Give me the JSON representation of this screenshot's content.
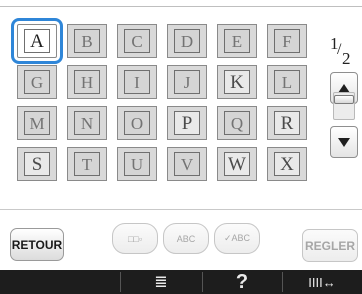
{
  "grid": {
    "cells": [
      {
        "label": "A",
        "kind": "letter",
        "selected": true
      },
      {
        "label": "B",
        "kind": "deco"
      },
      {
        "label": "C",
        "kind": "deco"
      },
      {
        "label": "D",
        "kind": "deco"
      },
      {
        "label": "E",
        "kind": "deco"
      },
      {
        "label": "F",
        "kind": "deco"
      },
      {
        "label": "G",
        "kind": "deco"
      },
      {
        "label": "H",
        "kind": "deco"
      },
      {
        "label": "I",
        "kind": "deco"
      },
      {
        "label": "J",
        "kind": "deco"
      },
      {
        "label": "K",
        "kind": "letter"
      },
      {
        "label": "L",
        "kind": "deco"
      },
      {
        "label": "M",
        "kind": "deco"
      },
      {
        "label": "N",
        "kind": "deco"
      },
      {
        "label": "O",
        "kind": "deco"
      },
      {
        "label": "P",
        "kind": "letter"
      },
      {
        "label": "Q",
        "kind": "deco"
      },
      {
        "label": "R",
        "kind": "letter"
      },
      {
        "label": "S",
        "kind": "letter"
      },
      {
        "label": "T",
        "kind": "deco"
      },
      {
        "label": "U",
        "kind": "deco"
      },
      {
        "label": "V",
        "kind": "deco"
      },
      {
        "label": "W",
        "kind": "letter"
      },
      {
        "label": "X",
        "kind": "letter"
      }
    ]
  },
  "pager": {
    "current": "1",
    "slash": "/",
    "total": "2"
  },
  "buttons": {
    "retour": "RETOUR",
    "regler": "REGLER",
    "mode1": "□□▫",
    "mode2": "ABC",
    "mode3": "✓ABC"
  },
  "bottom": {
    "item1": "≣",
    "item2": "?",
    "item3": "IIII↔"
  },
  "colors": {
    "selection": "#2f86d8",
    "bar": "#1d1d1d"
  }
}
